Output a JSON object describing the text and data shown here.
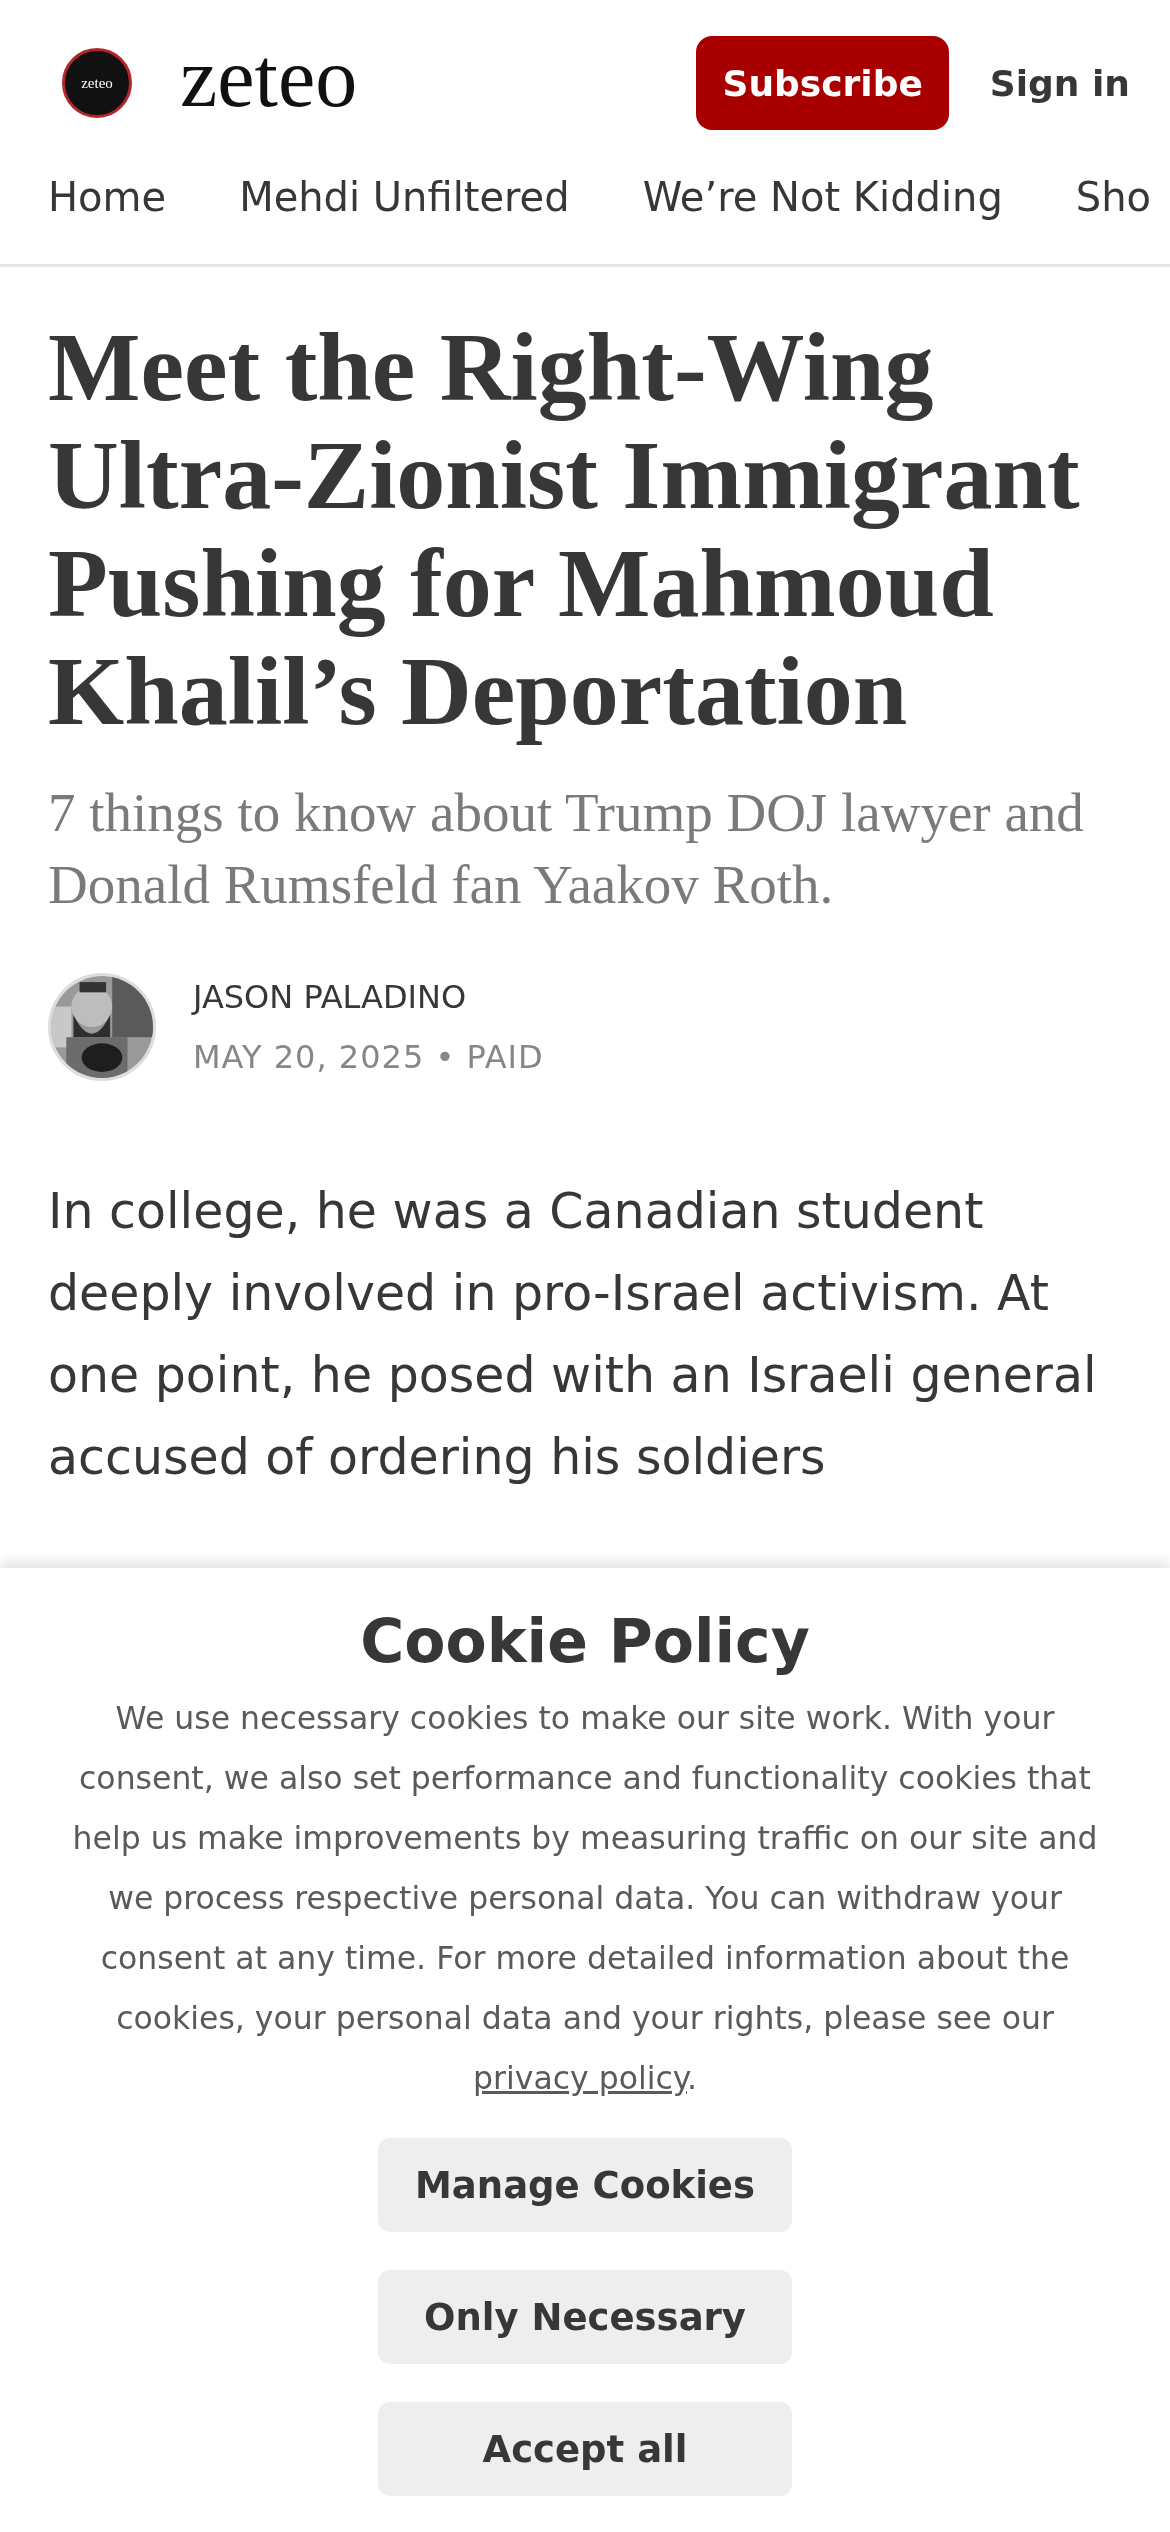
{
  "header": {
    "logo_badge": "zeteo",
    "wordmark": "zeteo",
    "subscribe_button": "Subscribe",
    "sign_in_link": "Sign in"
  },
  "nav": [
    {
      "label": "Home"
    },
    {
      "label": "Mehdi Unfiltered"
    },
    {
      "label": "We’re Not Kidding"
    },
    {
      "label": "Sho"
    }
  ],
  "article": {
    "title": "Meet the Right-Wing Ultra-Zionist Immigrant Pushing for Mahmoud Khalil’s Deportation",
    "subtitle": "7 things to know about Trump DOJ lawyer and Donald Rumsfeld fan Yaakov Roth.",
    "author": "JASON PALADINO",
    "date": "MAY 20, 2025",
    "separator": "•",
    "access": "PAID",
    "body": "In college, he was a Canadian student deeply involved in pro-Israel activism. At one point, he posed with an Israeli general accused of ordering his soldiers"
  },
  "cookie_banner": {
    "title": "Cookie Policy",
    "text": "We use necessary cookies to make our site work. With your consent, we also set performance and functionality cookies that help us make improvements by measuring traffic on our site and we process respective personal data. You can withdraw your consent at any time. For more detailed information about the cookies, your personal data and your rights, please see our",
    "link": "privacy policy",
    "link_suffix": ".",
    "buttons": [
      "Manage Cookies",
      "Only Necessary",
      "Accept all"
    ]
  }
}
